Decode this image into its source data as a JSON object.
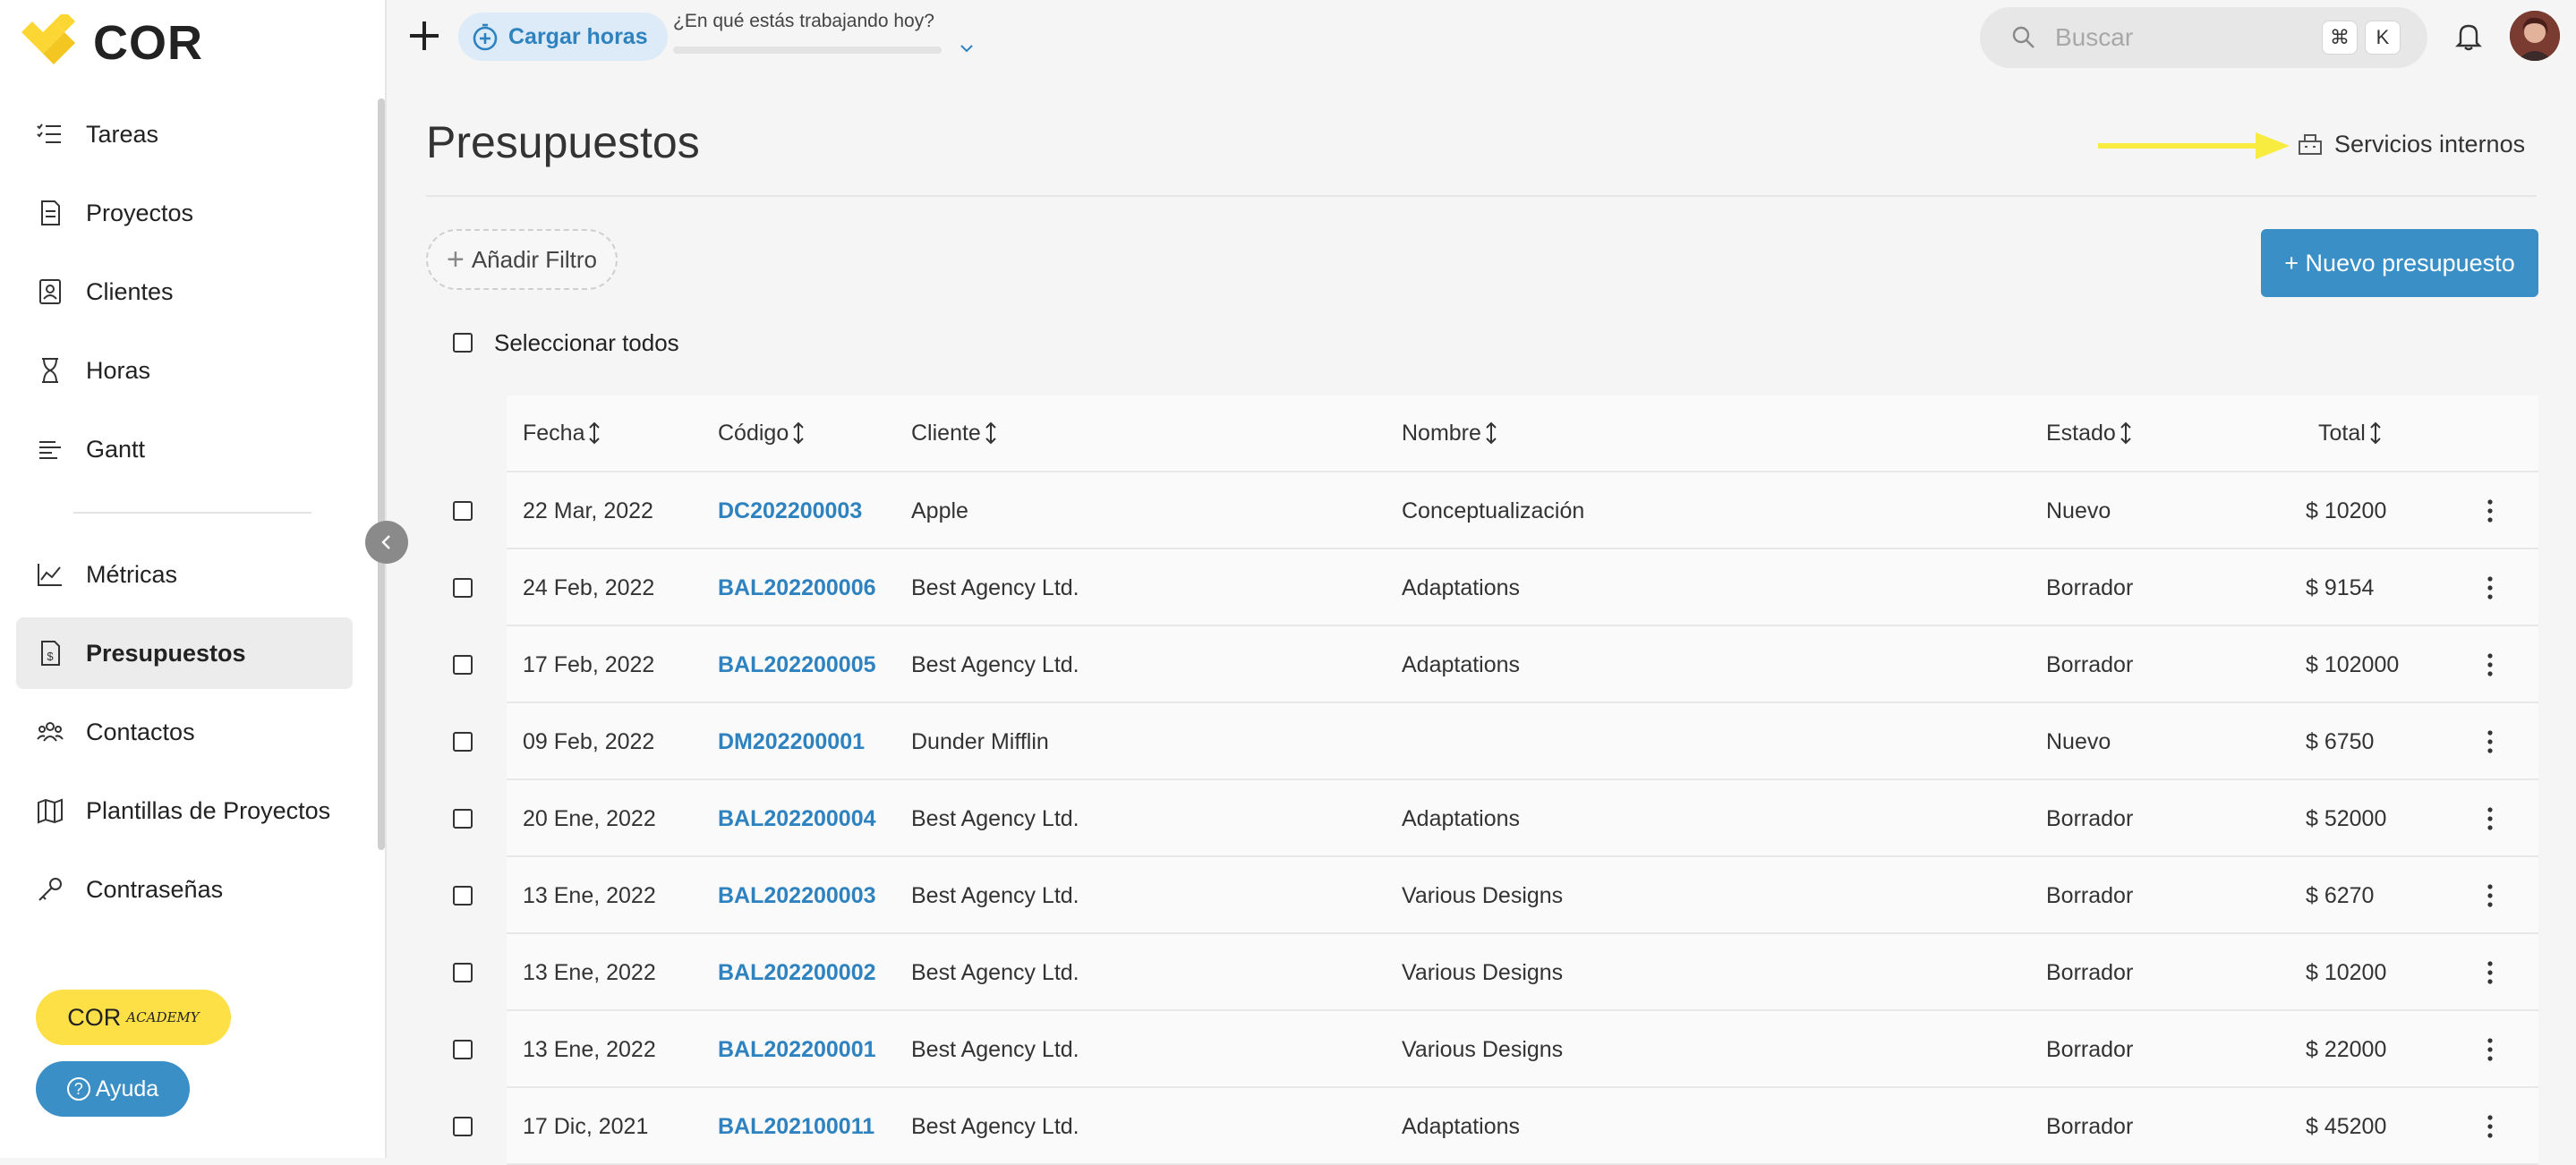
{
  "brand": {
    "name": "COR",
    "yellow": "#fcd734",
    "accent": "#3a8fc7"
  },
  "sidebar": {
    "items": [
      {
        "label": "Tareas",
        "icon": "task-list-icon"
      },
      {
        "label": "Proyectos",
        "icon": "project-icon"
      },
      {
        "label": "Clientes",
        "icon": "client-icon"
      },
      {
        "label": "Horas",
        "icon": "hourglass-icon"
      },
      {
        "label": "Gantt",
        "icon": "gantt-icon"
      },
      {
        "label": "Métricas",
        "icon": "metrics-icon"
      },
      {
        "label": "Presupuestos",
        "icon": "budget-icon",
        "active": true
      },
      {
        "label": "Contactos",
        "icon": "contacts-icon"
      },
      {
        "label": "Plantillas de Proyectos",
        "icon": "map-icon"
      },
      {
        "label": "Contraseñas",
        "icon": "key-icon"
      }
    ],
    "academy_label": "COR",
    "academy_sub": "ACADEMY",
    "help_label": "Ayuda"
  },
  "topbar": {
    "cargar_label": "Cargar horas",
    "working_label": "¿En qué estás trabajando hoy?",
    "search_placeholder": "Buscar",
    "kbd_cmd": "⌘",
    "kbd_k": "K"
  },
  "main": {
    "title": "Presupuestos",
    "internal_link": "Servicios internos",
    "filter_label": "Añadir Filtro",
    "new_button": "+ Nuevo presupuesto",
    "select_all": "Seleccionar todos",
    "columns": [
      "Fecha",
      "Código",
      "Cliente",
      "Nombre",
      "Estado",
      "Total"
    ],
    "rows": [
      {
        "fecha": "22 Mar, 2022",
        "codigo": "DC202200003",
        "cliente": "Apple",
        "nombre": "Conceptualización",
        "estado": "Nuevo",
        "total": "$  10200"
      },
      {
        "fecha": "24 Feb, 2022",
        "codigo": "BAL202200006",
        "cliente": "Best Agency Ltd.",
        "nombre": "Adaptations",
        "estado": "Borrador",
        "total": "$  9154"
      },
      {
        "fecha": "17 Feb, 2022",
        "codigo": "BAL202200005",
        "cliente": "Best Agency Ltd.",
        "nombre": "Adaptations",
        "estado": "Borrador",
        "total": "$  102000"
      },
      {
        "fecha": "09 Feb, 2022",
        "codigo": "DM202200001",
        "cliente": "Dunder Mifflin",
        "nombre": "",
        "estado": "Nuevo",
        "total": "$  6750"
      },
      {
        "fecha": "20 Ene, 2022",
        "codigo": "BAL202200004",
        "cliente": "Best Agency Ltd.",
        "nombre": "Adaptations",
        "estado": "Borrador",
        "total": "$  52000"
      },
      {
        "fecha": "13 Ene, 2022",
        "codigo": "BAL202200003",
        "cliente": "Best Agency Ltd.",
        "nombre": "Various Designs",
        "estado": "Borrador",
        "total": "$  6270"
      },
      {
        "fecha": "13 Ene, 2022",
        "codigo": "BAL202200002",
        "cliente": "Best Agency Ltd.",
        "nombre": "Various Designs",
        "estado": "Borrador",
        "total": "$  10200"
      },
      {
        "fecha": "13 Ene, 2022",
        "codigo": "BAL202200001",
        "cliente": "Best Agency Ltd.",
        "nombre": "Various Designs",
        "estado": "Borrador",
        "total": "$  22000"
      },
      {
        "fecha": "17 Dic, 2021",
        "codigo": "BAL202100011",
        "cliente": "Best Agency Ltd.",
        "nombre": "Adaptations",
        "estado": "Borrador",
        "total": "$  45200"
      }
    ]
  }
}
